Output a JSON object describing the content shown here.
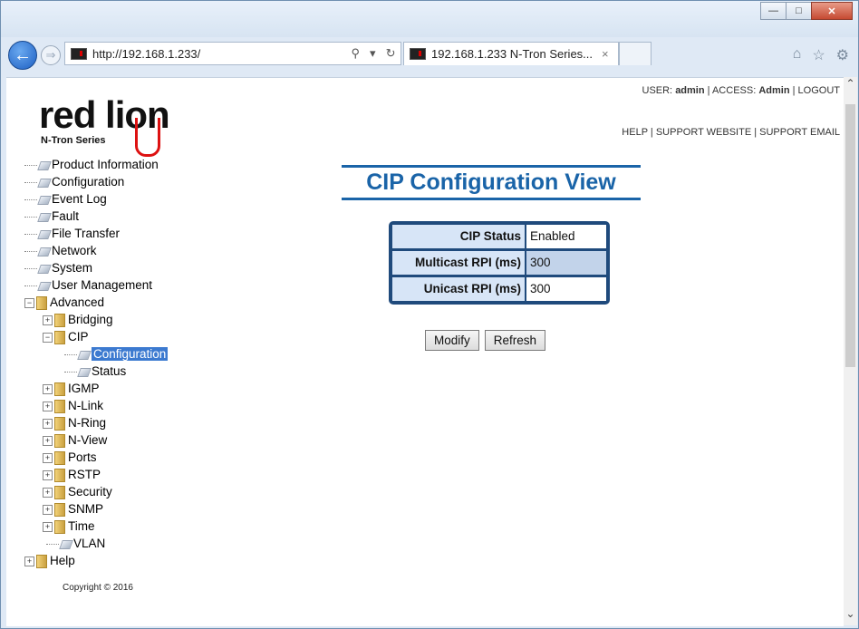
{
  "browser": {
    "url": "http://192.168.1.233/",
    "tab_title": "192.168.1.233 N-Tron Series...",
    "tab_close": "×"
  },
  "header": {
    "logo_text": "red lion",
    "logo_sub": "N-Tron Series",
    "user_label": "USER:",
    "user": "admin",
    "access_label": "ACCESS:",
    "access": "Admin",
    "logout": "LOGOUT",
    "help": "HELP",
    "support_website": "SUPPORT WEBSITE",
    "support_email": "SUPPORT EMAIL"
  },
  "tree": {
    "items": [
      "Product Information",
      "Configuration",
      "Event Log",
      "Fault",
      "File Transfer",
      "Network",
      "System",
      "User Management",
      "Advanced",
      "Bridging",
      "CIP",
      "Configuration",
      "Status",
      "IGMP",
      "N-Link",
      "N-Ring",
      "N-View",
      "Ports",
      "RSTP",
      "Security",
      "SNMP",
      "Time",
      "VLAN",
      "Help"
    ]
  },
  "main": {
    "title": "CIP Configuration View",
    "rows": [
      {
        "label": "CIP Status",
        "value": "Enabled"
      },
      {
        "label": "Multicast RPI (ms)",
        "value": "300"
      },
      {
        "label": "Unicast RPI (ms)",
        "value": "300"
      }
    ],
    "modify": "Modify",
    "refresh": "Refresh"
  },
  "footer": {
    "copyright": "Copyright © 2016"
  }
}
